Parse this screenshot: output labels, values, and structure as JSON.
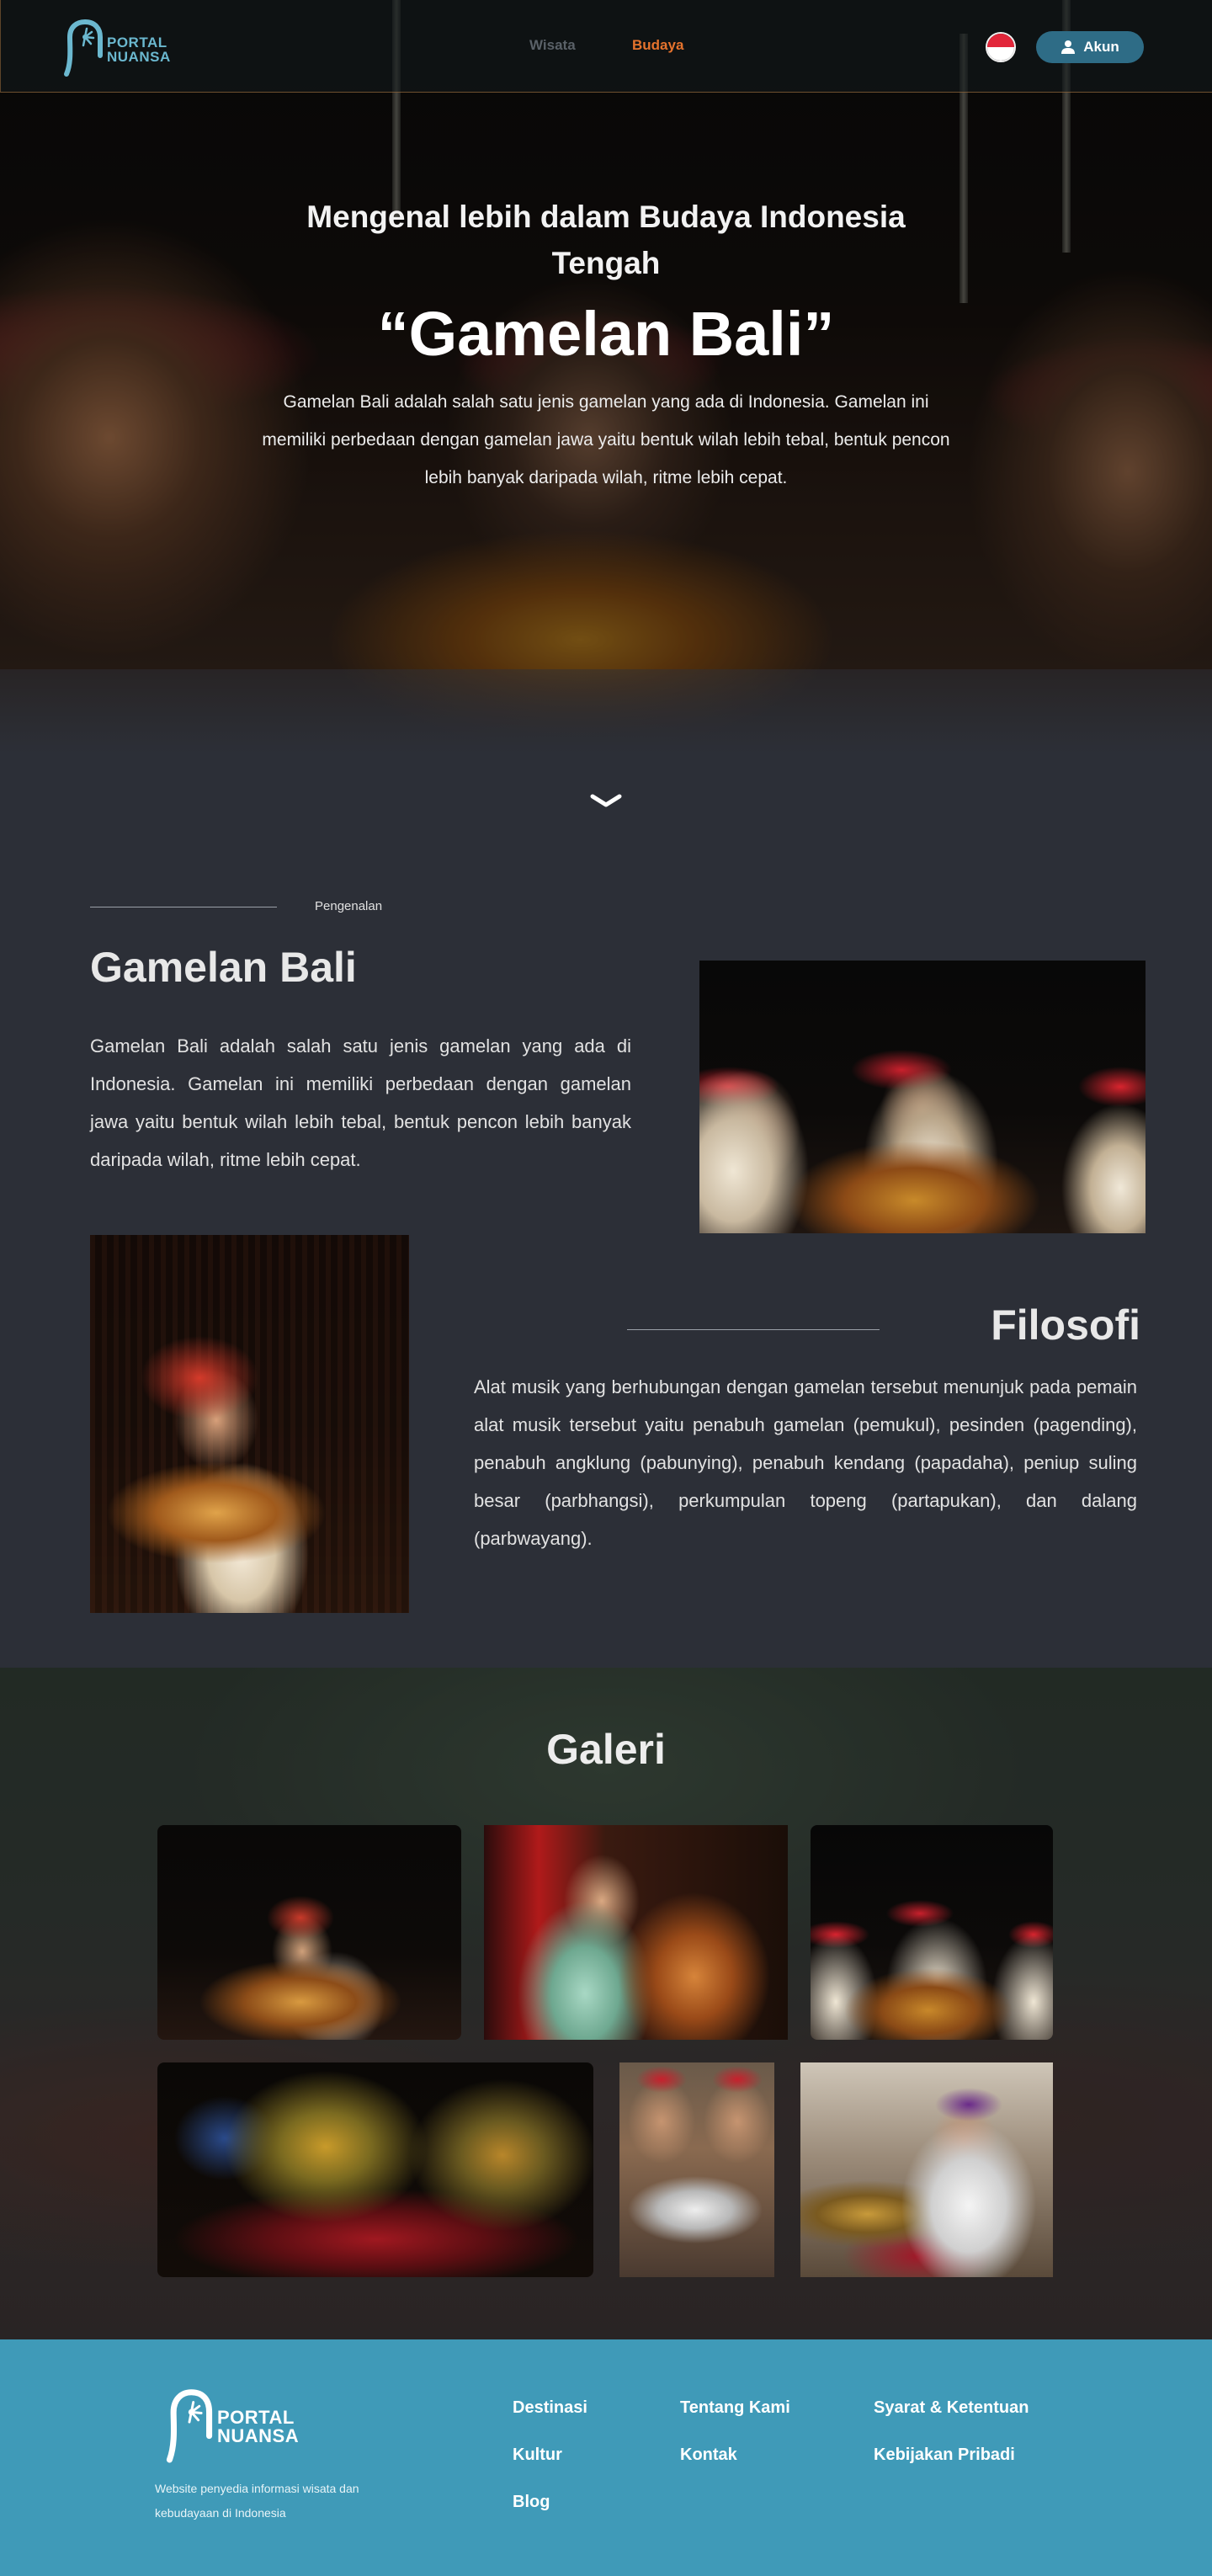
{
  "header": {
    "logo_line1": "PORTAL",
    "logo_line2": "NUANSA",
    "nav": [
      {
        "label": "Wisata"
      },
      {
        "label": "Budaya"
      }
    ],
    "account_label": "Akun"
  },
  "hero": {
    "subtitle": "Mengenal lebih dalam Budaya Indonesia Tengah",
    "title": "“Gamelan Bali”",
    "description": "Gamelan Bali adalah salah satu jenis gamelan yang ada di Indonesia. Gamelan ini memiliki perbedaan dengan gamelan jawa yaitu bentuk wilah lebih tebal, bentuk pencon lebih banyak daripada wilah, ritme lebih cepat."
  },
  "intro": {
    "label": "Pengenalan",
    "heading": "Gamelan Bali",
    "text": "Gamelan Bali adalah salah satu jenis gamelan yang ada di Indonesia. Gamelan ini memiliki perbedaan dengan gamelan jawa yaitu bentuk wilah lebih tebal, bentuk pencon lebih banyak daripada wilah, ritme lebih cepat."
  },
  "philosophy": {
    "heading": "Filosofi",
    "text": "Alat musik yang berhubungan dengan gamelan tersebut menunjuk pada pemain alat musik tersebut yaitu penabuh gamelan (pemukul), pesinden (pagending), penabuh angklung (pabunying), penabuh kendang (papadaha), peniup suling besar (parbhangsi), perkumpulan topeng (partapukan), dan dalang (parbwayang)."
  },
  "gallery": {
    "title": "Galeri"
  },
  "footer": {
    "logo_line1": "PORTAL",
    "logo_line2": "NUANSA",
    "tagline": "Website penyedia informasi wisata dan kebudayaan di Indonesia",
    "links": [
      {
        "label": "Destinasi"
      },
      {
        "label": "Kultur"
      },
      {
        "label": "Blog"
      },
      {
        "label": "Tentang Kami"
      },
      {
        "label": "Kontak"
      },
      {
        "label": "Syarat & Ketentuan"
      },
      {
        "label": "Kebijakan Pribadi"
      }
    ]
  },
  "colors": {
    "accent": "#e5732d",
    "account_button": "#2e6c86",
    "footer": "#3f9ab8",
    "section_background": "#2c2f37"
  }
}
